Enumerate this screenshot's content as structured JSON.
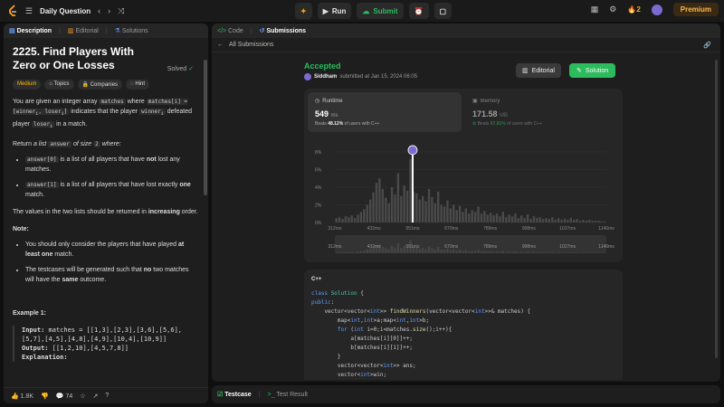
{
  "topbar": {
    "title": "Daily Question",
    "run": "Run",
    "submit": "Submit",
    "streak": "2",
    "premium": "Premium"
  },
  "left_tabs": {
    "description": "Description",
    "editorial": "Editorial",
    "solutions": "Solutions"
  },
  "problem": {
    "title": "2225. Find Players With Zero or One Losses",
    "status": "Solved",
    "difficulty": "Medium",
    "chips": [
      "Topics",
      "Companies",
      "Hint"
    ],
    "p1a": "You are given an integer array",
    "p1_code1": "matches",
    "p1b": "where",
    "p1_code2": "matches[i] = [winner",
    "p1_code3": "loser",
    "p1c": "indicates that the player",
    "p1_code4": "winner",
    "p1d": "defeated player",
    "p1_code5": "loser",
    "p1e": "in a match.",
    "p2a": "Return",
    "p2b": "a list",
    "p2_code1": "answer",
    "p2c": "of size",
    "p2_code2": "2",
    "p2d": "where:",
    "li1_code": "answer[0]",
    "li1a": "is a list of all players that have",
    "li1b": "not",
    "li1c": "lost any matches.",
    "li2_code": "answer[1]",
    "li2a": "is a list of all players that have lost exactly",
    "li2b": "one",
    "li2c": "match.",
    "p3a": "The values in the two lists should be returned in",
    "p3b": "increasing",
    "p3c": "order.",
    "note": "Note:",
    "n1a": "You should only consider the players that have played",
    "n1b": "at least one",
    "n1c": "match.",
    "n2a": "The testcases will be generated such that",
    "n2b": "no",
    "n2c": "two matches will have the",
    "n2d": "same",
    "n2e": "outcome.",
    "example": "Example 1:",
    "input_label": "Input:",
    "input_val": "matches = [[1,3],[2,3],[3,6],[5,6],[5,7],[4,5],[4,8],[4,9],[10,4],[10,9]]",
    "output_label": "Output:",
    "output_val": "[[1,2,10],[4,5,7,8]]",
    "explanation": "Explanation:"
  },
  "footer": {
    "likes": "1.8K",
    "comments": "74"
  },
  "right_tabs": {
    "code": "Code",
    "submissions": "Submissions",
    "back": "All Submissions"
  },
  "result": {
    "status": "Accepted",
    "user": "Siddham",
    "submitted": "submitted at Jan 15, 2024 06:05",
    "editorial_btn": "Editorial",
    "solution_btn": "Solution"
  },
  "runtime": {
    "label": "Runtime",
    "value": "549",
    "unit": "ms",
    "beats_prefix": "Beats",
    "beats": "48.12%",
    "beats_suffix": "of users with C++"
  },
  "memory": {
    "label": "Memory",
    "value": "171.58",
    "unit": "MB",
    "beats_prefix": "Beats",
    "beats": "57.81%",
    "beats_suffix": "of users with C++"
  },
  "chart_data": {
    "type": "bar",
    "ylabel": "",
    "xlabel": "",
    "y_ticks": [
      "8%",
      "6%",
      "4%",
      "2%",
      "0%"
    ],
    "ylim": [
      0,
      8
    ],
    "x_ticks": [
      "312ms",
      "432ms",
      "551ms",
      "670ms",
      "789ms",
      "908ms",
      "1027ms",
      "1146ms"
    ],
    "xlim": [
      312,
      1146
    ],
    "bar_width_ms": 8.5,
    "values": [
      0.5,
      0.6,
      0.4,
      0.7,
      0.6,
      0.8,
      0.5,
      0.9,
      1.2,
      1.5,
      2.0,
      2.6,
      3.4,
      4.5,
      5.0,
      3.8,
      2.8,
      2.2,
      4.0,
      3.2,
      5.6,
      3.0,
      4.2,
      3.6,
      7.2,
      3.5,
      3.3,
      2.6,
      3.0,
      2.4,
      3.8,
      2.9,
      2.2,
      3.5,
      2.0,
      1.8,
      2.5,
      1.6,
      2.0,
      1.4,
      1.9,
      1.2,
      1.6,
      1.0,
      1.4,
      1.2,
      1.8,
      1.0,
      1.3,
      0.9,
      1.1,
      0.8,
      1.0,
      0.7,
      1.2,
      0.6,
      0.9,
      0.7,
      1.0,
      0.5,
      0.8,
      0.5,
      0.9,
      0.4,
      0.7,
      0.5,
      0.6,
      0.4,
      0.5,
      0.4,
      0.6,
      0.3,
      0.5,
      0.3,
      0.4,
      0.3,
      0.5,
      0.3,
      0.4,
      0.2,
      0.3,
      0.2,
      0.3,
      0.2,
      0.2,
      0.2,
      0.1,
      0.1
    ],
    "highlight_x": "551ms",
    "highlight_value": 7.8,
    "colors": {
      "bar": "#4a4a4a",
      "highlight": "#ffffff",
      "grid": "#333333"
    }
  },
  "code": {
    "lang": "C++",
    "lines": [
      "class Solution {",
      "public:",
      "    vector<vector<int>> findWinners(vector<vector<int>>& matches) {",
      "        map<int,int>a;map<int,int>b;",
      "        for (int i=0;i<matches.size();i++){",
      "            a[matches[i][0]]++;",
      "            b[matches[i][1]]++;",
      "        }",
      "        vector<vector<int>> ans;",
      "        vector<int>win;"
    ]
  },
  "bottom": {
    "testcase": "Testcase",
    "result": "Test Result"
  }
}
